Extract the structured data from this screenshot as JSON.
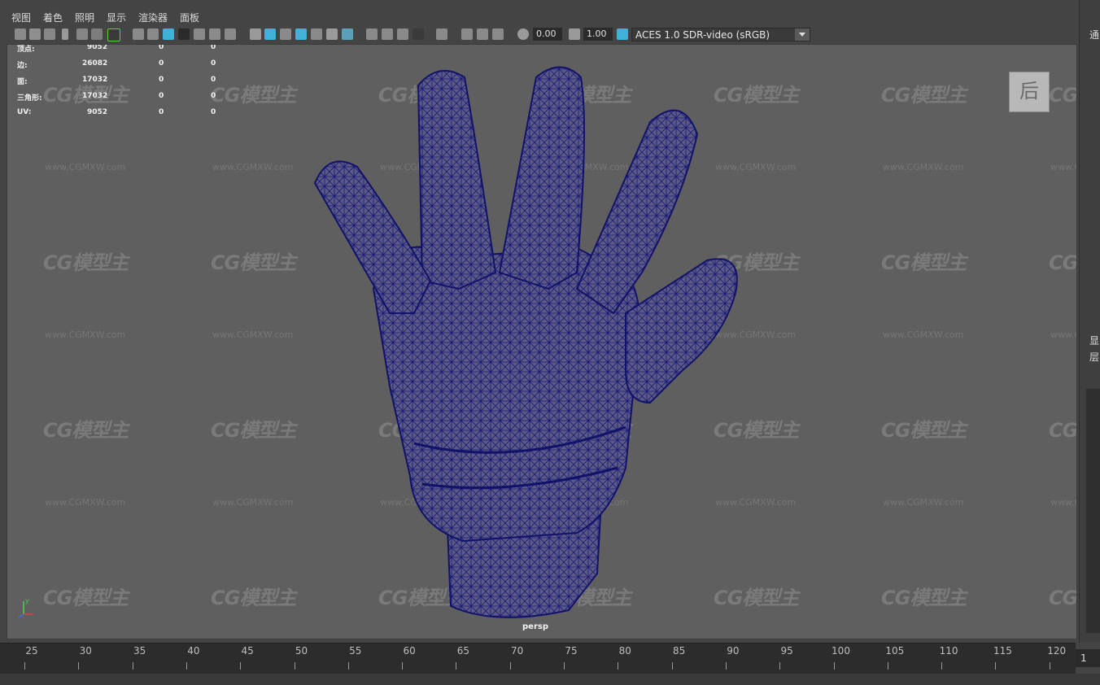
{
  "menu": {
    "items": [
      "视图",
      "着色",
      "照明",
      "显示",
      "渲染器",
      "面板"
    ]
  },
  "toolbar": {
    "exposure_value": "0.00",
    "gamma_value": "1.00",
    "color_space": "ACES 1.0 SDR-video (sRGB)"
  },
  "hud": {
    "rows": [
      {
        "label": "顶点:",
        "v1": "9052",
        "v2": "0",
        "v3": "0"
      },
      {
        "label": "边:",
        "v1": "26082",
        "v2": "0",
        "v3": "0"
      },
      {
        "label": "面:",
        "v1": "17032",
        "v2": "0",
        "v3": "0"
      },
      {
        "label": "三角形:",
        "v1": "17032",
        "v2": "0",
        "v3": "0"
      },
      {
        "label": "UV:",
        "v1": "9052",
        "v2": "0",
        "v3": "0"
      }
    ]
  },
  "viewport": {
    "camera_label": "persp",
    "view_cube_label": "后",
    "axis_y": "y",
    "axis_x": "x",
    "watermark_text": "CG模型主",
    "watermark_url": "www.CGMXW.com",
    "mesh_color": "#14146e"
  },
  "right_panel": {
    "top_text": "通",
    "mid_text_1": "显",
    "mid_text_2": "层"
  },
  "timeline": {
    "ticks": [
      "25",
      "30",
      "35",
      "40",
      "45",
      "50",
      "55",
      "60",
      "65",
      "70",
      "75",
      "80",
      "85",
      "90",
      "95",
      "100",
      "105",
      "110",
      "115",
      "120"
    ],
    "current_frame": "1"
  },
  "colors": {
    "viewport_bg": "#5f5f5f",
    "ui_bg": "#444444",
    "active_icon": "#3fb2d9",
    "active_outline": "#59d13a"
  }
}
